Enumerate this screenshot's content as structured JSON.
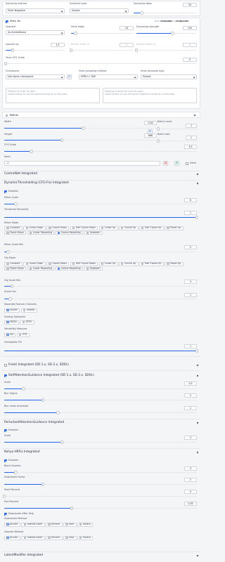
{
  "sampling": {
    "method_label": "Sampling method",
    "method": "Euler Negative",
    "schedule_label": "Schedule type",
    "schedule": "Simple",
    "steps_label": "Sampling steps",
    "steps": "20"
  },
  "hires": {
    "title": "Hires. fix",
    "from_label": "from",
    "from": "1152x896",
    "to_label": "to",
    "to": "1728x1344",
    "upscaler_label": "Upscaler",
    "upscaler": "4x-AnimeSharp",
    "steps_label": "Hires steps",
    "steps": "10",
    "denoise_label": "Denoising strength",
    "denoise": "0.6",
    "upscale_label": "Upscale by",
    "upscale": "1.5",
    "resize_w_label": "Resize width to",
    "resize_w": "0",
    "resize_h_label": "Resize height to",
    "resize_h": "0",
    "cfg_label": "Hires CFG Scale",
    "cfg": "0",
    "checkpoint_label": "Checkpoint",
    "checkpoint": "Use same checkpoint",
    "sampler_label": "Hires sampling method",
    "sampler": "DPM++ SDE",
    "schedule_label": "Hires schedule type",
    "schedule": "Simple",
    "prompt_placeholder": "Prompt for hires fix pass.\nLeave empty to use the same prompt as in first pass.",
    "neg_placeholder": "Negative prompt for hires fix pass.\nLeave empty to use the same negative prompt as in first pass."
  },
  "refiner": {
    "title": "Refiner"
  },
  "size": {
    "width_label": "Width",
    "width": "1152",
    "height_label": "Height",
    "height": "896",
    "batch_count_label": "Batch count",
    "batch_count": "1",
    "batch_size_label": "Batch size",
    "batch_size": "1",
    "cfg_label": "CFG Scale",
    "cfg": "4.5",
    "seed_label": "Seed",
    "seed": "-1",
    "extra_label": "Extra"
  },
  "controlnet": {
    "title": "ControlNet Integrated"
  },
  "dyn": {
    "title": "DynamicThresholding (CFG-Fix) Integrated",
    "enabled_label": "Enabled",
    "mimic_label": "Mimic Scale",
    "mimic": "6",
    "pct_label": "Threshold Percentile",
    "pct": "1",
    "mimic_mode_label": "Mimic Mode",
    "cfg_mode_label": "Cfg Mode",
    "modes": [
      "Constant",
      "Linear Down",
      "Cosine Down",
      "Half Cosine Down",
      "Linear Up",
      "Cosine Up",
      "Half Cosine Up",
      "Power Up",
      "Power Down",
      "Linear Repeating",
      "Cosine Repeating",
      "Sawtooth"
    ],
    "mimic_min_label": "Mimic Scale Min",
    "mimic_min": "2",
    "cfg_min_label": "Cfg Scale Min",
    "cfg_min": "4",
    "sched_label": "Sched Val",
    "sched": "1",
    "sep_label": "Separate Feature Channels",
    "sep_opts": [
      "enable",
      "disable"
    ],
    "scaling_label": "Scaling Startpoint",
    "scaling_opts": [
      "MEAN",
      "ZERO"
    ],
    "var_label": "Variability Measure",
    "var_opts": [
      "AD",
      "STD"
    ],
    "interp_label": "Interpolate Phi",
    "interp": "1"
  },
  "freeu": {
    "title": "FreeU Integrated (SD 1.x, SD 2.x, SDXL)"
  },
  "sag": {
    "title": "SelfAttentionGuidance Integrated (SD 1.x, SD 2.x, SDXL)",
    "scale_label": "Scale",
    "scale": "0.5",
    "blur_label": "Blur Sigma",
    "blur": "2",
    "thr_label": "Blur mask threshold",
    "thr": "1"
  },
  "pag": {
    "title": "PerturbedAttentionGuidance Integrated",
    "enabled_label": "Enabled",
    "scale_label": "Scale",
    "scale": "3"
  },
  "kohya": {
    "title": "Kohya HRFix Integrated",
    "enabled_label": "Enabled",
    "block_label": "Block Number",
    "block": "3",
    "down_label": "Downscale Factor",
    "down": "2",
    "start_label": "Start Percent",
    "start": "0",
    "end_label": "End Percent",
    "end": "0.35",
    "after_label": "Downscale After Skip",
    "dmeth_label": "Downscale Method",
    "umeth_label": "Upscale Method",
    "methods": [
      "bicubic",
      "nearest-exact",
      "bilinear",
      "area",
      "bislerp"
    ]
  },
  "latent": {
    "title": "LatentModifier Integrated"
  },
  "colors": {
    "accent": "#2563eb",
    "bg": "#f4f5f7",
    "card": "#ffffff"
  }
}
